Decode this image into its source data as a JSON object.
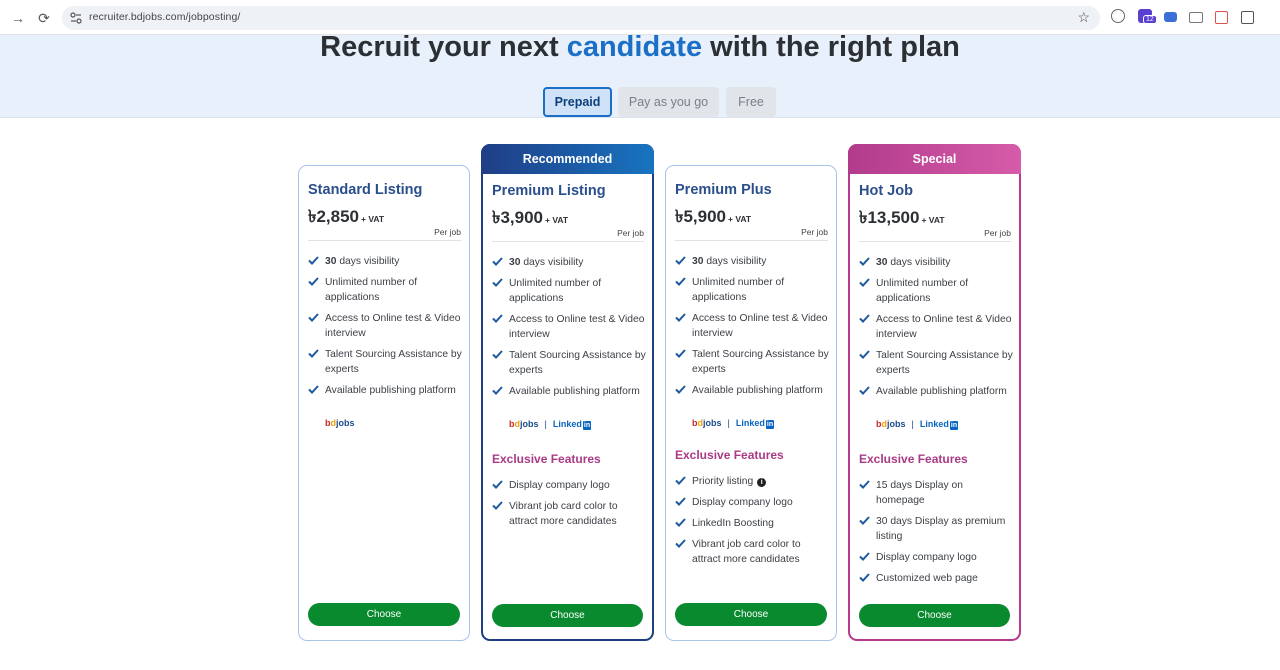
{
  "browser": {
    "url": "recruiter.bdjobs.com/jobposting/",
    "extension_badge": "12"
  },
  "hero": {
    "title_before": "Recruit your next",
    "title_accent": "candidate",
    "title_after": "with the right plan",
    "tabs": [
      "Prepaid",
      "Pay as you go",
      "Free"
    ],
    "active_tab": "Prepaid"
  },
  "colors": {
    "accent": "#1b6fc6",
    "choose_button": "#0a8a2e",
    "plan_name": "#2b4f8c",
    "exclusive": "#a93a86"
  },
  "plans": [
    {
      "banner": "",
      "name": "Standard Listing",
      "price": "৳2,850",
      "vat": "+ VAT",
      "per": "Per job",
      "features": [
        {
          "bold": "30",
          "text": " days visibility"
        },
        {
          "bold": "",
          "text": "Unlimited number of applications"
        },
        {
          "bold": "",
          "text": "Access to Online test & Video interview"
        },
        {
          "bold": "",
          "text": "Talent Sourcing Assistance by experts"
        },
        {
          "bold": "",
          "text": "Available publishing platform"
        }
      ],
      "platforms": [
        "bdjobs"
      ],
      "exclusive_title": "",
      "exclusive": [],
      "button": "Choose"
    },
    {
      "banner": "Recommended",
      "name": "Premium Listing",
      "price": "৳3,900",
      "vat": "+ VAT",
      "per": "Per job",
      "features": [
        {
          "bold": "30",
          "text": " days visibility"
        },
        {
          "bold": "",
          "text": "Unlimited number of applications"
        },
        {
          "bold": "",
          "text": "Access to Online test & Video interview"
        },
        {
          "bold": "",
          "text": "Talent Sourcing Assistance by experts"
        },
        {
          "bold": "",
          "text": "Available publishing platform"
        }
      ],
      "platforms": [
        "bdjobs",
        "LinkedIn"
      ],
      "exclusive_title": "Exclusive Features",
      "exclusive": [
        "Display company logo",
        "Vibrant job card color to attract more candidates"
      ],
      "button": "Choose"
    },
    {
      "banner": "",
      "name": "Premium Plus",
      "price": "৳5,900",
      "vat": "+ VAT",
      "per": "Per job",
      "features": [
        {
          "bold": "30",
          "text": " days visibility"
        },
        {
          "bold": "",
          "text": "Unlimited number of applications"
        },
        {
          "bold": "",
          "text": "Access to Online test & Video interview"
        },
        {
          "bold": "",
          "text": "Talent Sourcing Assistance by experts"
        },
        {
          "bold": "",
          "text": "Available publishing platform"
        }
      ],
      "platforms": [
        "bdjobs",
        "LinkedIn"
      ],
      "exclusive_title": "Exclusive Features",
      "exclusive": [
        "Priority listing",
        "Display company logo",
        "LinkedIn Boosting",
        "Vibrant job card color to attract more candidates"
      ],
      "button": "Choose"
    },
    {
      "banner": "Special",
      "name": "Hot Job",
      "price": "৳13,500",
      "vat": "+ VAT",
      "per": "Per job",
      "features": [
        {
          "bold": "30",
          "text": " days visibility"
        },
        {
          "bold": "",
          "text": "Unlimited number of applications"
        },
        {
          "bold": "",
          "text": "Access to Online test & Video interview"
        },
        {
          "bold": "",
          "text": "Talent Sourcing Assistance by experts"
        },
        {
          "bold": "",
          "text": "Available publishing platform"
        }
      ],
      "platforms": [
        "bdjobs",
        "LinkedIn"
      ],
      "exclusive_title": "Exclusive Features",
      "exclusive": [
        "15 days Display on homepage",
        "30 days Display as premium listing",
        "Display company logo",
        "Customized web page"
      ],
      "button": "Choose"
    }
  ],
  "logo_text": {
    "bdjobs_b": "b",
    "bdjobs_d": "d",
    "bdjobs_rest": "jobs",
    "linkedin_word": "Linked",
    "linkedin_box": "in",
    "separator": "|"
  }
}
